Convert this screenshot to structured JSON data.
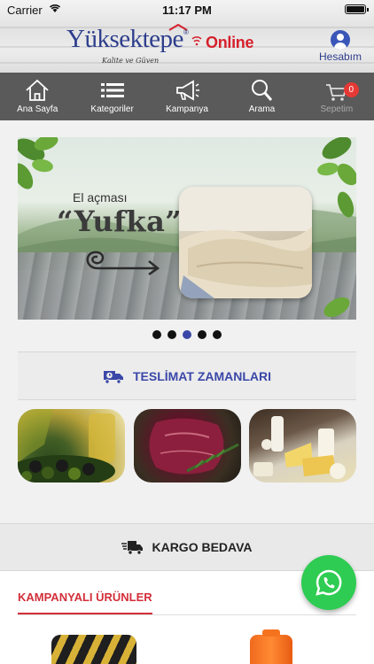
{
  "status_bar": {
    "carrier": "Carrier",
    "time": "11:17 PM"
  },
  "header": {
    "logo_text": "Yüksektepe",
    "logo_online": "Online",
    "logo_tagline": "Kalite ve Güven",
    "account_label": "Hesabım"
  },
  "nav": {
    "items": [
      {
        "label": "Ana Sayfa",
        "icon": "home-icon"
      },
      {
        "label": "Kategoriler",
        "icon": "list-icon"
      },
      {
        "label": "Kampanya",
        "icon": "megaphone-icon"
      },
      {
        "label": "Arama",
        "icon": "search-icon"
      },
      {
        "label": "Sepetim",
        "icon": "cart-icon"
      }
    ],
    "cart_count": "0"
  },
  "banner": {
    "subtitle": "El açması",
    "title": "“Yufka”",
    "slide_count": 5,
    "active_slide": 3
  },
  "delivery": {
    "label": "TESLİMAT ZAMANLARI",
    "icon": "truck-clock-icon"
  },
  "categories": [
    {
      "name": "olive-oil-tile",
      "icon": "olive-oil-image"
    },
    {
      "name": "meat-tile",
      "icon": "meat-image"
    },
    {
      "name": "dairy-tile",
      "icon": "dairy-image"
    }
  ],
  "shipping": {
    "label": "KARGO BEDAVA",
    "icon": "delivery-truck-icon"
  },
  "campaign": {
    "title": "KAMPANYALI ÜRÜNLER"
  },
  "colors": {
    "brand_blue": "#2d3e8c",
    "brand_red": "#d6212c",
    "nav_bg": "#5a5a5a",
    "whatsapp": "#2ecc52"
  }
}
